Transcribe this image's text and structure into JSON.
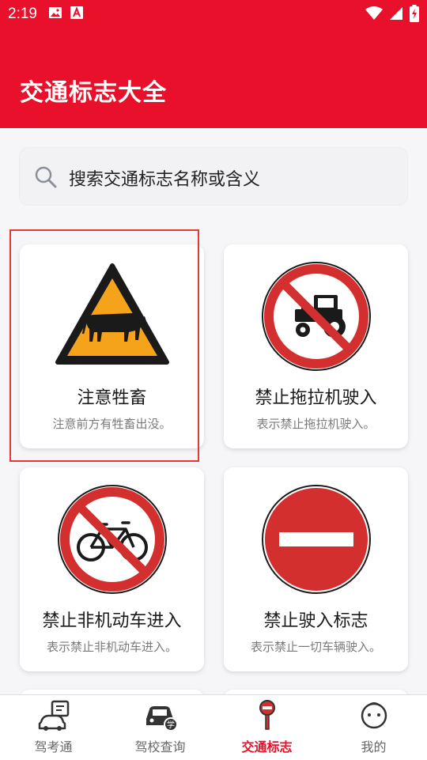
{
  "status_bar": {
    "time": "2:19",
    "icons": [
      "image-icon",
      "text-a-icon",
      "wifi-icon",
      "signal-icon",
      "battery-charging-icon"
    ]
  },
  "app_bar": {
    "title": "交通标志大全"
  },
  "search": {
    "placeholder": "搜索交通标志名称或含义"
  },
  "cards": [
    {
      "title": "注意牲畜",
      "desc": "注意前方有牲畜出没。",
      "icon": "livestock-warning-icon"
    },
    {
      "title": "禁止拖拉机驶入",
      "desc": "表示禁止拖拉机驶入。",
      "icon": "no-tractor-icon"
    },
    {
      "title": "禁止非机动车进入",
      "desc": "表示禁止非机动车进入。",
      "icon": "no-bicycle-icon"
    },
    {
      "title": "禁止驶入标志",
      "desc": "表示禁止一切车辆驶入。",
      "icon": "no-entry-icon"
    }
  ],
  "bottom_nav": [
    {
      "label": "驾考通",
      "icon": "driving-test-icon",
      "active": false
    },
    {
      "label": "驾校查询",
      "icon": "driving-school-icon",
      "active": false
    },
    {
      "label": "交通标志",
      "icon": "traffic-sign-icon",
      "active": true
    },
    {
      "label": "我的",
      "icon": "profile-icon",
      "active": false
    }
  ],
  "colors": {
    "primary": "#e8102a",
    "warning_yellow": "#f5a31a",
    "prohibition_red": "#d32f2f"
  }
}
